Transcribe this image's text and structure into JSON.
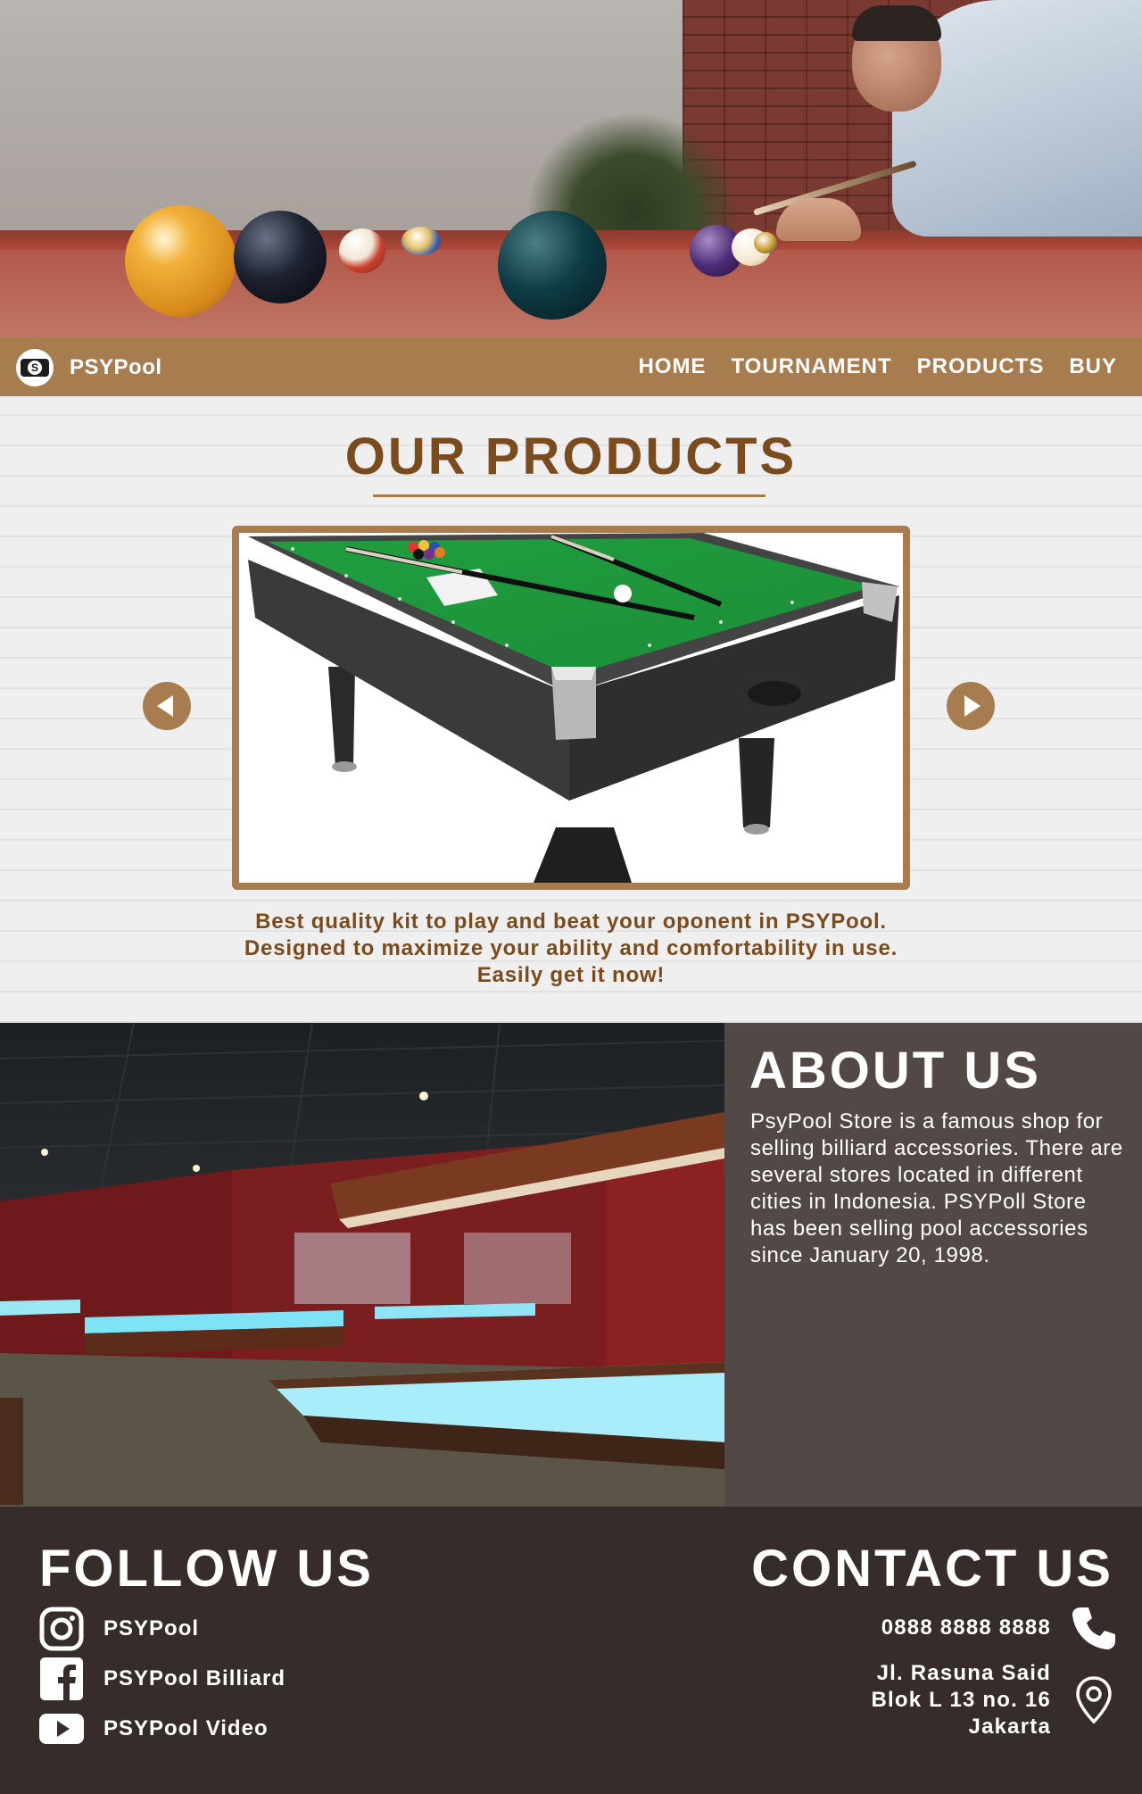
{
  "nav": {
    "brand": "PSYPool",
    "items": [
      {
        "label": "HOME"
      },
      {
        "label": "TOURNAMENT"
      },
      {
        "label": "PRODUCTS"
      },
      {
        "label": "BUY"
      }
    ]
  },
  "products": {
    "title": "OUR PRODUCTS",
    "description_lines": [
      "Best quality kit to play and beat your oponent in PSYPool.",
      "Designed to maximize your ability and comfortability in use.",
      "Easily get it now!"
    ]
  },
  "about": {
    "title": "ABOUT US",
    "text": "PsyPool Store is a famous shop for selling billiard accessories. There are several stores located in different cities in Indonesia. PSYPoll Store has been selling pool accessories since January 20, 1998."
  },
  "footer": {
    "follow_title": "FOLLOW US",
    "social": [
      {
        "icon": "instagram-icon",
        "label": "PSYPool"
      },
      {
        "icon": "facebook-icon",
        "label": "PSYPool Billiard"
      },
      {
        "icon": "youtube-icon",
        "label": "PSYPool Video"
      }
    ],
    "contact_title": "CONTACT US",
    "phone": "0888 8888 8888",
    "address_lines": [
      "Jl. Rasuna Said",
      "Blok L 13 no. 16",
      "Jakarta"
    ]
  },
  "colors": {
    "nav_bg": "#a77d4f",
    "accent_brown": "#7a4b1c",
    "about_bg": "#524846",
    "footer_bg": "#362c2a"
  }
}
